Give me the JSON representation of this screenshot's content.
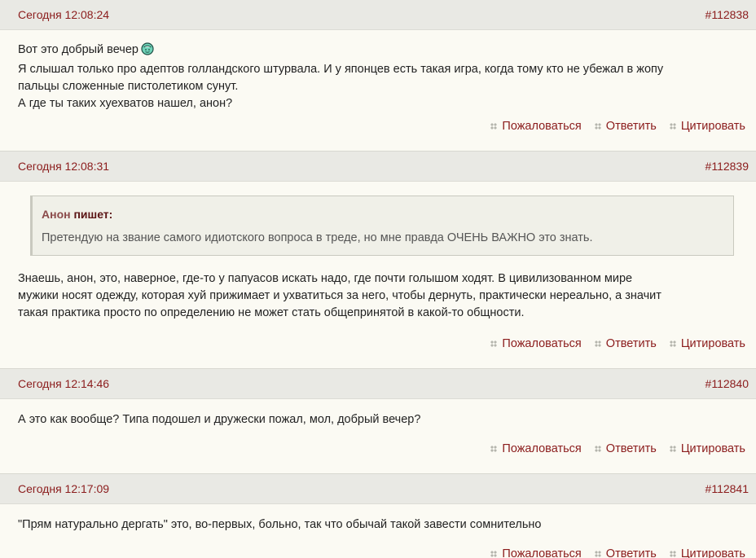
{
  "posts": [
    {
      "date": "Сегодня 12:08:24",
      "number": "#112838",
      "lines": [
        "Вот это добрый вечер",
        "Я слышал только про адептов голландского штурвала. И у японцев есть такая игра, когда тому кто не убежал в жопу",
        "пальцы сложенные пистолетиком сунут.",
        "А где ты таких хуехватов нашел, анон?"
      ],
      "smiley_icon": "smiley-icon"
    },
    {
      "date": "Сегодня 12:08:31",
      "number": "#112839",
      "quote": {
        "author": "Анон",
        "says": "пишет:",
        "text": "Претендую на звание самого идиотского вопроса в треде, но мне правда ОЧЕНЬ ВАЖНО это знать."
      },
      "lines": [
        "Знаешь, анон, это, наверное, где-то у папуасов искать надо, где почти голышом ходят. В цивилизованном мире",
        "мужики носят одежду, которая хуй прижимает и ухватиться за него, чтобы дернуть, практически нереально, а значит",
        "такая практика просто по определению не может стать общепринятой в какой-то общности."
      ]
    },
    {
      "date": "Сегодня 12:14:46",
      "number": "#112840",
      "lines": [
        "А это как вообще? Типа подошел и дружески пожал, мол, добрый вечер?"
      ]
    },
    {
      "date": "Сегодня 12:17:09",
      "number": "#112841",
      "lines": [
        "\"Прям натурально дергать\" это, во-первых, больно, так что обычай такой завести сомнительно"
      ]
    }
  ],
  "actions": {
    "report": "Пожаловаться",
    "reply": "Ответить",
    "quote": "Цитировать"
  },
  "colors": {
    "link": "#8b1c1c",
    "header_bg": "#e9e9e4",
    "page_bg": "#fbfaf3"
  }
}
